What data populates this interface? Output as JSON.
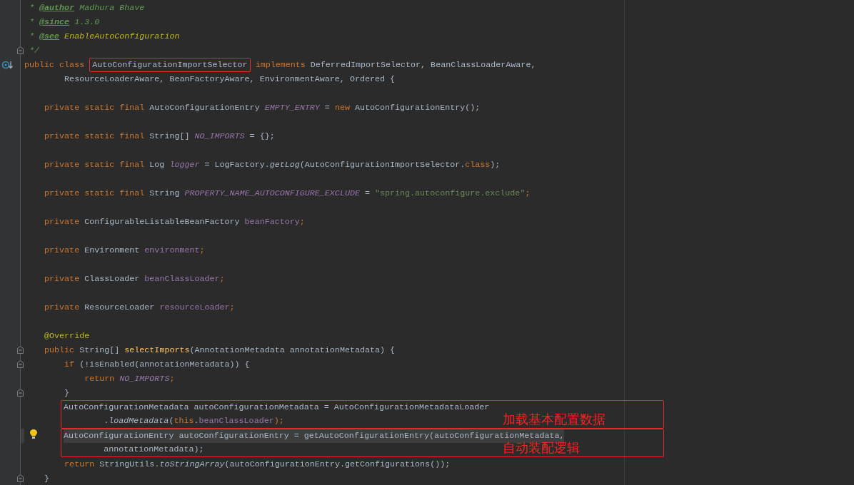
{
  "editor": {
    "lines": [
      {
        "tokens": [
          {
            "text": " * ",
            "kind": "doc"
          },
          {
            "text": "@author",
            "kind": "doctag"
          },
          {
            "text": " Madhura Bhave",
            "kind": "doc"
          }
        ]
      },
      {
        "tokens": [
          {
            "text": " * ",
            "kind": "doc"
          },
          {
            "text": "@since",
            "kind": "doctag"
          },
          {
            "text": " 1.3.0",
            "kind": "doc"
          }
        ]
      },
      {
        "tokens": [
          {
            "text": " * ",
            "kind": "doc"
          },
          {
            "text": "@see",
            "kind": "doctag"
          },
          {
            "text": " EnableAutoConfiguration",
            "kind": "docref"
          }
        ]
      },
      {
        "gutter": {
          "kind": "fold"
        },
        "tokens": [
          {
            "text": " */",
            "kind": "doc"
          }
        ]
      },
      {
        "gutter": {
          "kind": "implements"
        },
        "tokens": [
          {
            "text": "public class ",
            "kind": "kw"
          },
          {
            "text": "AutoConfigurationImportSelector",
            "kind": "boxed"
          },
          {
            "text": " implements ",
            "kind": "kw"
          },
          {
            "text": "DeferredImportSelector, BeanClassLoaderAware,",
            "kind": "id"
          }
        ]
      },
      {
        "tokens": [
          {
            "text": "        ResourceLoaderAware, BeanFactoryAware, EnvironmentAware, Ordered {",
            "kind": "id"
          }
        ]
      },
      {
        "kind": "blank"
      },
      {
        "tokens": [
          {
            "text": "    private static final ",
            "kind": "kw"
          },
          {
            "text": "AutoConfigurationEntry ",
            "kind": "id"
          },
          {
            "text": "EMPTY_ENTRY",
            "kind": "static"
          },
          {
            "text": " = ",
            "kind": "id"
          },
          {
            "text": "new ",
            "kind": "kw"
          },
          {
            "text": "AutoConfigurationEntry();",
            "kind": "id"
          }
        ]
      },
      {
        "kind": "blank"
      },
      {
        "tokens": [
          {
            "text": "    private static final ",
            "kind": "kw"
          },
          {
            "text": "String[] ",
            "kind": "id"
          },
          {
            "text": "NO_IMPORTS",
            "kind": "static"
          },
          {
            "text": " = {};",
            "kind": "id"
          }
        ]
      },
      {
        "kind": "blank"
      },
      {
        "tokens": [
          {
            "text": "    private static final ",
            "kind": "kw"
          },
          {
            "text": "Log ",
            "kind": "id"
          },
          {
            "text": "logger",
            "kind": "static"
          },
          {
            "text": " = LogFactory.",
            "kind": "id"
          },
          {
            "text": "getLog",
            "kind": "call"
          },
          {
            "text": "(AutoConfigurationImportSelector.",
            "kind": "id"
          },
          {
            "text": "class",
            "kind": "kw"
          },
          {
            "text": ");",
            "kind": "id"
          }
        ]
      },
      {
        "kind": "blank"
      },
      {
        "tokens": [
          {
            "text": "    private static final ",
            "kind": "kw"
          },
          {
            "text": "String ",
            "kind": "id"
          },
          {
            "text": "PROPERTY_NAME_AUTOCONFIGURE_EXCLUDE",
            "kind": "static"
          },
          {
            "text": " = ",
            "kind": "id"
          },
          {
            "text": "\"spring.autoconfigure.exclude\"",
            "kind": "str"
          },
          {
            "text": ";",
            "kind": "kw"
          }
        ]
      },
      {
        "kind": "blank"
      },
      {
        "tokens": [
          {
            "text": "    private ",
            "kind": "kw"
          },
          {
            "text": "ConfigurableListableBeanFactory ",
            "kind": "id"
          },
          {
            "text": "beanFactory",
            "kind": "field"
          },
          {
            "text": ";",
            "kind": "kw"
          }
        ]
      },
      {
        "kind": "blank"
      },
      {
        "tokens": [
          {
            "text": "    private ",
            "kind": "kw"
          },
          {
            "text": "Environment ",
            "kind": "id"
          },
          {
            "text": "environment",
            "kind": "field"
          },
          {
            "text": ";",
            "kind": "kw"
          }
        ]
      },
      {
        "kind": "blank"
      },
      {
        "tokens": [
          {
            "text": "    private ",
            "kind": "kw"
          },
          {
            "text": "ClassLoader ",
            "kind": "id"
          },
          {
            "text": "beanClassLoader",
            "kind": "field"
          },
          {
            "text": ";",
            "kind": "kw"
          }
        ]
      },
      {
        "kind": "blank"
      },
      {
        "tokens": [
          {
            "text": "    private ",
            "kind": "kw"
          },
          {
            "text": "ResourceLoader ",
            "kind": "id"
          },
          {
            "text": "resourceLoader",
            "kind": "field"
          },
          {
            "text": ";",
            "kind": "kw"
          }
        ]
      },
      {
        "kind": "blank"
      },
      {
        "tokens": [
          {
            "text": "    @Override",
            "kind": "ann"
          }
        ]
      },
      {
        "gutter": {
          "kind": "fold"
        },
        "tokens": [
          {
            "text": "    public ",
            "kind": "kw"
          },
          {
            "text": "String[] ",
            "kind": "id"
          },
          {
            "text": "selectImports",
            "kind": "decl"
          },
          {
            "text": "(AnnotationMetadata annotationMetadata) {",
            "kind": "id"
          }
        ]
      },
      {
        "gutter": {
          "kind": "fold"
        },
        "tokens": [
          {
            "text": "        if ",
            "kind": "kw"
          },
          {
            "text": "(!isEnabled(annotationMetadata)) {",
            "kind": "id"
          }
        ]
      },
      {
        "tokens": [
          {
            "text": "            return ",
            "kind": "kw"
          },
          {
            "text": "NO_IMPORTS",
            "kind": "static"
          },
          {
            "text": ";",
            "kind": "kw"
          }
        ]
      },
      {
        "gutter": {
          "kind": "fold"
        },
        "tokens": [
          {
            "text": "        }",
            "kind": "id"
          }
        ]
      },
      {
        "kind": "callout",
        "label": "加载基本配置数据",
        "lines": [
          {
            "tokens": [
              {
                "text": "AutoConfigurationMetadata autoConfigurationMetadata = AutoConfigurationMetadataLoader",
                "kind": "id"
              }
            ]
          },
          {
            "tokens": [
              {
                "text": "        .",
                "kind": "id"
              },
              {
                "text": "loadMetadata",
                "kind": "call"
              },
              {
                "text": "(",
                "kind": "id"
              },
              {
                "text": "this",
                "kind": "kw"
              },
              {
                "text": ".",
                "kind": "id"
              },
              {
                "text": "beanClassLoader",
                "kind": "field"
              },
              {
                "text": ");",
                "kind": "kw"
              }
            ]
          }
        ]
      },
      {
        "kind": "callout",
        "label": "自动装配逻辑",
        "lines": [
          {
            "current": true,
            "gutter": {
              "kind": "bulb"
            },
            "tokens": [
              {
                "text": "AutoConfigurationEntry autoConfigurationEntry = getAutoConfigurationEntry(autoConfigurationMetadata,",
                "kind": "id"
              }
            ]
          },
          {
            "tokens": [
              {
                "text": "        annotationMetadata);",
                "kind": "id"
              }
            ]
          }
        ]
      },
      {
        "tokens": [
          {
            "text": "        return ",
            "kind": "kw"
          },
          {
            "text": "StringUtils.",
            "kind": "id"
          },
          {
            "text": "toStringArray",
            "kind": "call"
          },
          {
            "text": "(autoConfigurationEntry.getConfigurations());",
            "kind": "id"
          }
        ]
      },
      {
        "gutter": {
          "kind": "fold"
        },
        "tokens": [
          {
            "text": "    }",
            "kind": "id"
          }
        ]
      }
    ]
  }
}
